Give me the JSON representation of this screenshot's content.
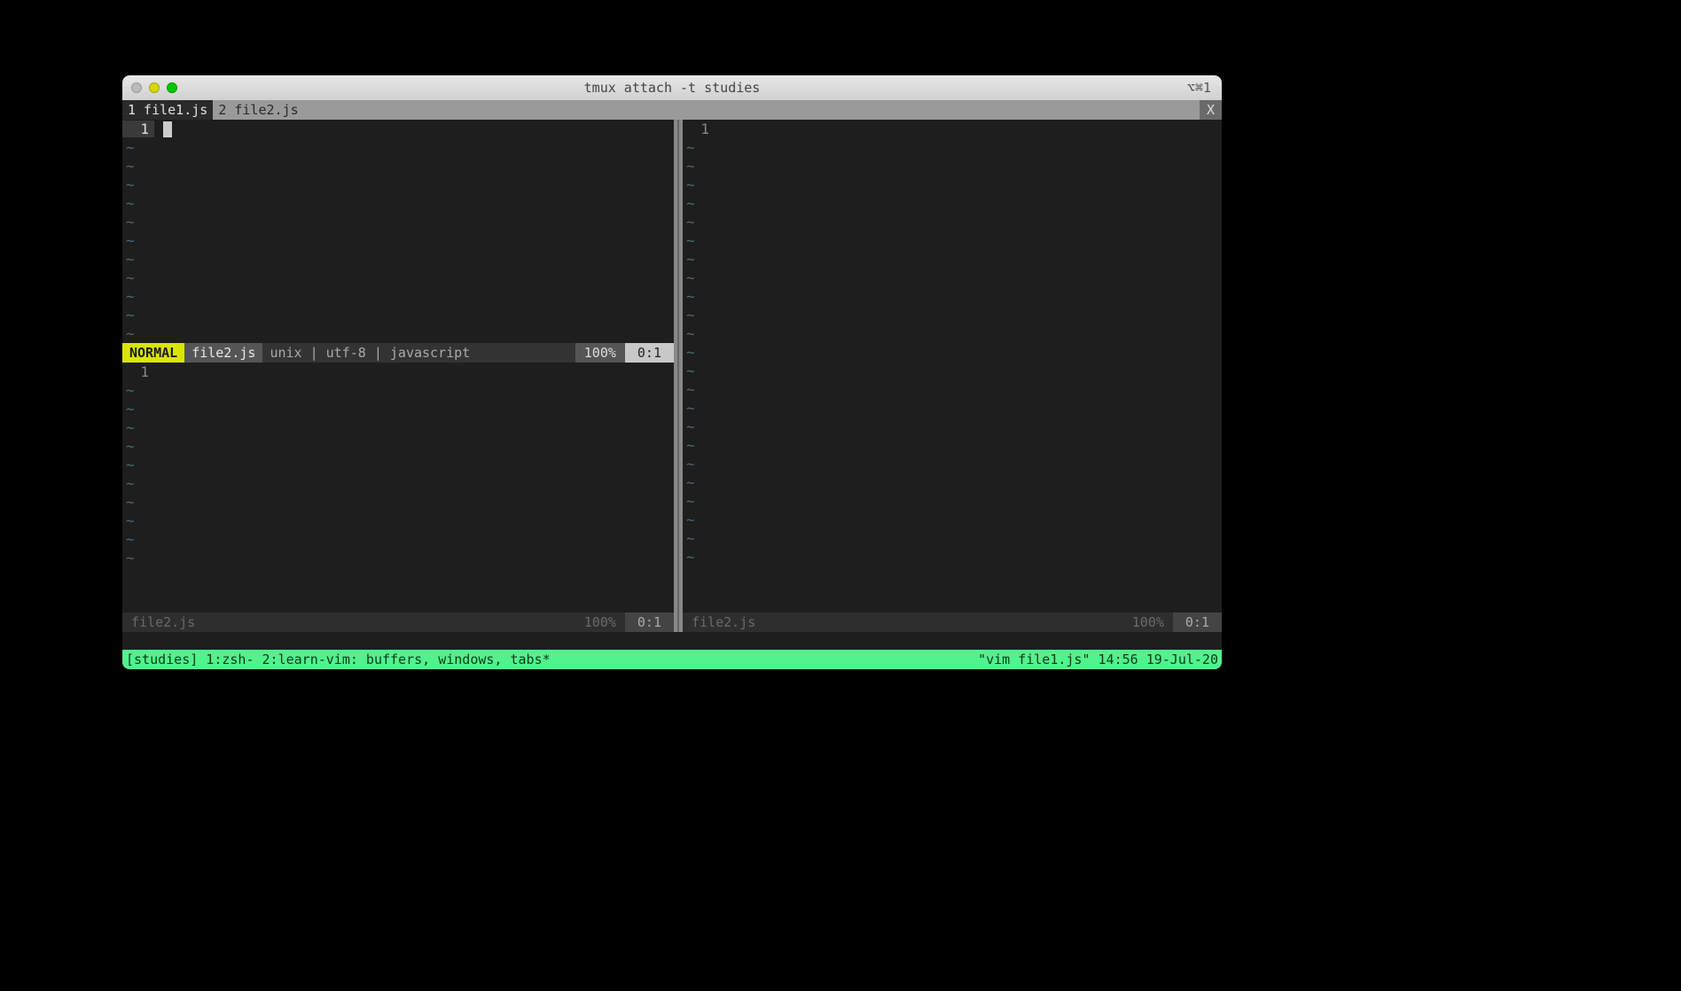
{
  "titlebar": {
    "title": "tmux attach -t studies",
    "right": "⌥⌘1"
  },
  "tabline": {
    "tabs": [
      {
        "label": "1 file1.js",
        "active": true
      },
      {
        "label": "2 file2.js",
        "active": false
      }
    ],
    "close": "X"
  },
  "panes": {
    "top_left": {
      "line_number": "1",
      "status": {
        "mode": "NORMAL",
        "file": "file2.js",
        "meta": "unix | utf-8 | javascript",
        "percent": "100%",
        "position": "0:1"
      },
      "tilde_count": 11
    },
    "bottom_left": {
      "line_number": "1",
      "status": {
        "file": "file2.js",
        "percent": "100%",
        "position": "0:1"
      },
      "tilde_count": 10
    },
    "right": {
      "line_number": "1",
      "status": {
        "file": "file2.js",
        "percent": "100%",
        "position": "0:1"
      },
      "tilde_count": 23
    }
  },
  "tmux": {
    "left": "[studies] 1:zsh- 2:learn-vim: buffers, windows, tabs*",
    "right": "\"vim file1.js\" 14:56 19-Jul-20"
  }
}
